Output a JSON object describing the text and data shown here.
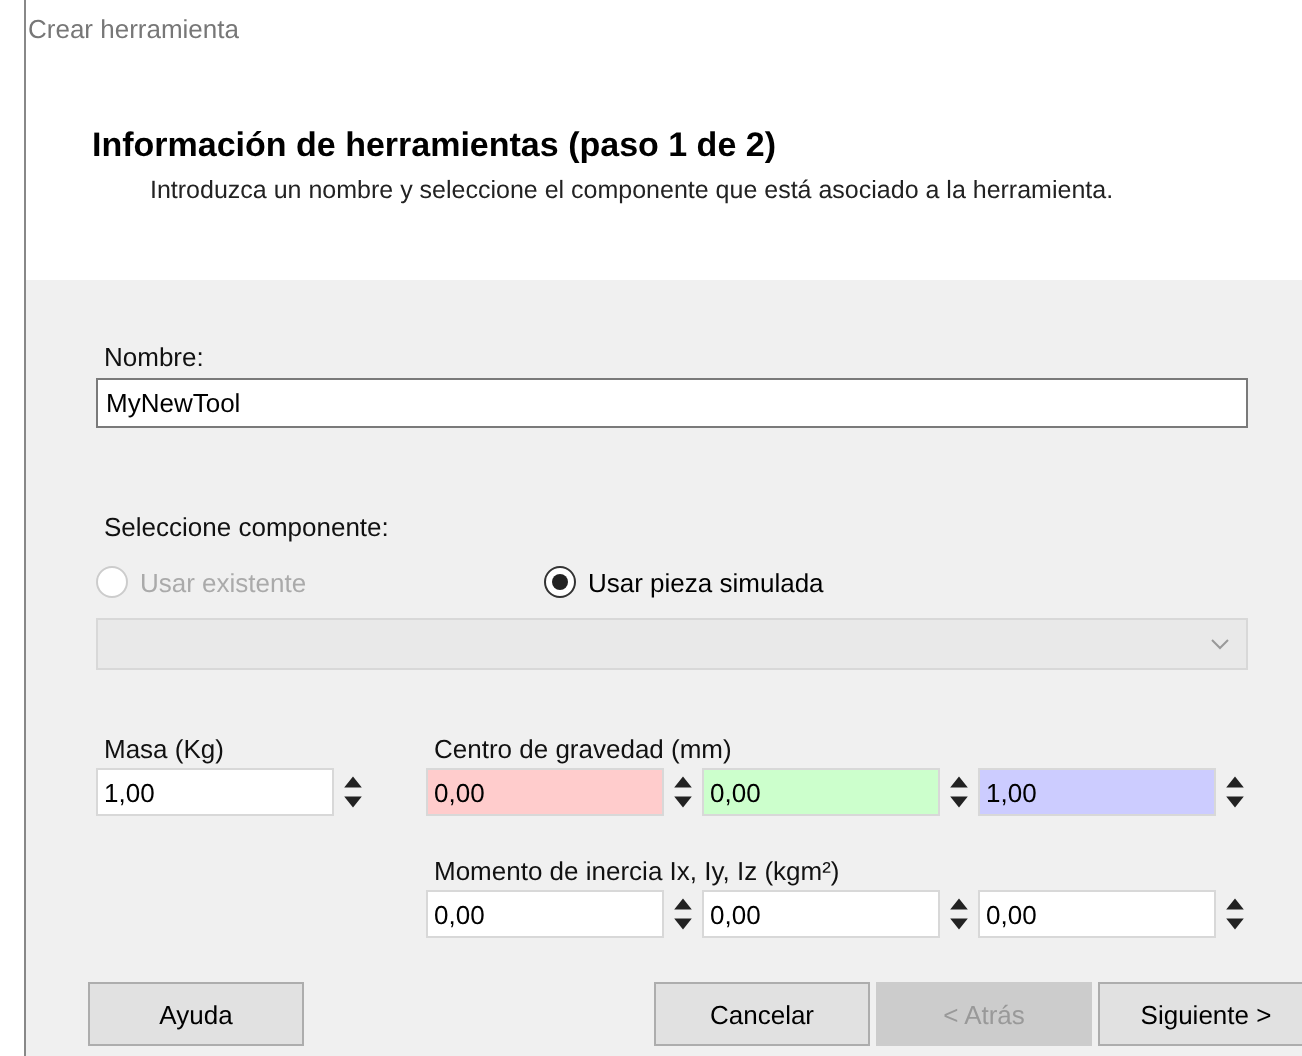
{
  "window": {
    "title": "Crear herramienta"
  },
  "header": {
    "title": "Información de herramientas (paso 1 de 2)",
    "description": "Introduzca un nombre y seleccione el componente que está asociado a la herramienta."
  },
  "name_field": {
    "label": "Nombre:",
    "value": "MyNewTool"
  },
  "component": {
    "label": "Seleccione componente:",
    "options": [
      {
        "label": "Usar existente",
        "selected": false,
        "disabled": true
      },
      {
        "label": "Usar pieza simulada",
        "selected": true,
        "disabled": false
      }
    ],
    "combobox": {
      "disabled": true
    }
  },
  "mass": {
    "label": "Masa (Kg)",
    "value": "1,00"
  },
  "center_of_gravity": {
    "label": "Centro de gravedad (mm)",
    "fields": [
      {
        "value": "0,00",
        "color": "#ffcccc"
      },
      {
        "value": "0,00",
        "color": "#ccffcc"
      },
      {
        "value": "1,00",
        "color": "#ccccff"
      }
    ]
  },
  "inertia": {
    "label": "Momento de inercia Ix, Iy, Iz (kgm²)",
    "fields": [
      {
        "value": "0,00"
      },
      {
        "value": "0,00"
      },
      {
        "value": "0,00"
      }
    ]
  },
  "buttons": [
    {
      "label": "Ayuda",
      "disabled": false
    },
    {
      "label": "Cancelar",
      "disabled": false
    },
    {
      "label": "< Atrás",
      "disabled": true
    },
    {
      "label": "Siguiente >",
      "disabled": false
    }
  ]
}
